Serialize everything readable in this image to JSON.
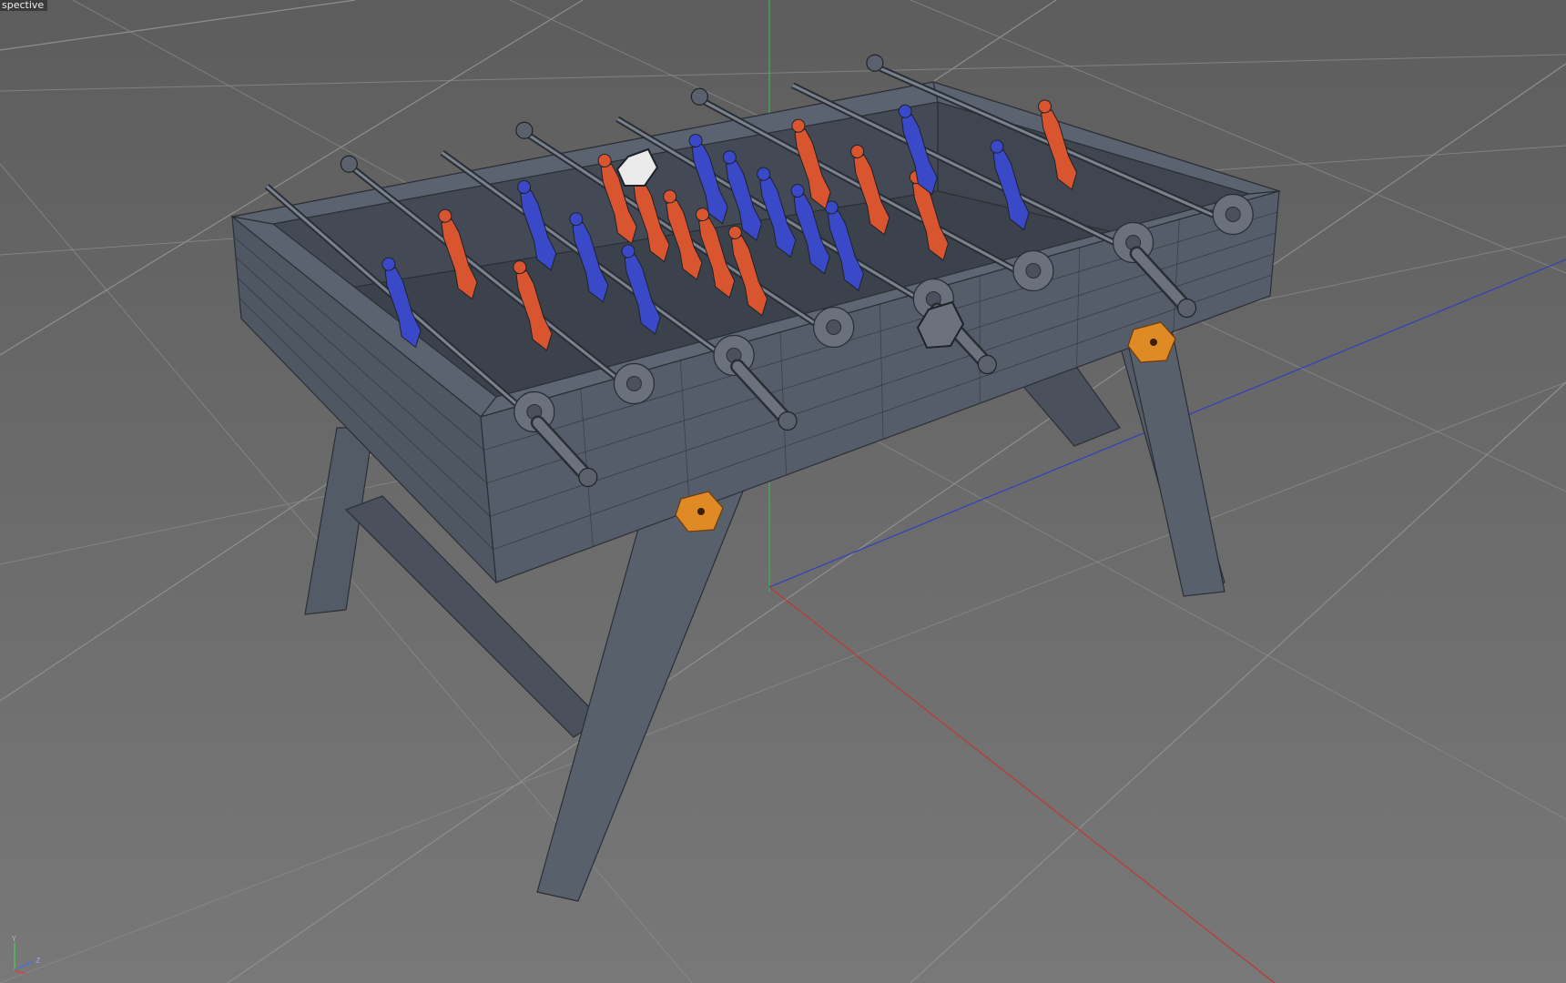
{
  "viewport": {
    "view_label": "spective",
    "background_top": "#5d5d5d",
    "background_bottom": "#787878"
  },
  "axis_gizmo": {
    "x_label": "Z",
    "y_label": "Y"
  },
  "scene": {
    "object": "foosball-table",
    "colors": {
      "grid": "#8f8f8f",
      "axis_x": "#c0392b",
      "axis_y": "#3fb34f",
      "axis_z": "#2e3fbf",
      "table": "#4e5662",
      "wire": "#2b2f35",
      "team_red": "#d9552f",
      "team_blue": "#3a49c8",
      "accent_orange": "#e08a25"
    }
  }
}
